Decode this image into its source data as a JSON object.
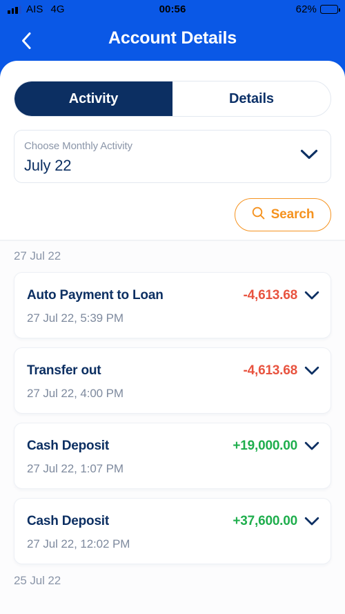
{
  "status_bar": {
    "carrier": "AIS",
    "network": "4G",
    "time": "00:56",
    "battery_percent": "62%",
    "battery_level": 62,
    "signal_icon": "signal-bars-icon",
    "battery_icon": "battery-icon"
  },
  "header": {
    "title": "Account Details",
    "back_icon": "chevron-left-icon"
  },
  "tabs": [
    {
      "label": "Activity",
      "active": true
    },
    {
      "label": "Details",
      "active": false
    }
  ],
  "month_select": {
    "label": "Choose Monthly Activity",
    "value": "July 22",
    "chevron_icon": "chevron-down-icon"
  },
  "search": {
    "label": "Search",
    "icon": "search-icon"
  },
  "colors": {
    "brand_blue": "#0A58E6",
    "navy": "#0C2F62",
    "orange": "#F5921E",
    "red": "#E8533F",
    "green": "#1FAE4D",
    "muted": "#8A95A8"
  },
  "groups": [
    {
      "date": "27 Jul 22",
      "transactions": [
        {
          "title": "Auto Payment to Loan",
          "amount": "-4,613.68",
          "sign": "negative",
          "datetime": "27 Jul 22, 5:39 PM",
          "chevron_icon": "chevron-down-icon"
        },
        {
          "title": "Transfer out",
          "amount": "-4,613.68",
          "sign": "negative",
          "datetime": "27 Jul 22, 4:00 PM",
          "chevron_icon": "chevron-down-icon"
        },
        {
          "title": "Cash Deposit",
          "amount": "+19,000.00",
          "sign": "positive",
          "datetime": "27 Jul 22, 1:07 PM",
          "chevron_icon": "chevron-down-icon"
        },
        {
          "title": "Cash Deposit",
          "amount": "+37,600.00",
          "sign": "positive",
          "datetime": "27 Jul 22, 12:02 PM",
          "chevron_icon": "chevron-down-icon"
        }
      ]
    },
    {
      "date": "25 Jul 22",
      "transactions": []
    }
  ]
}
